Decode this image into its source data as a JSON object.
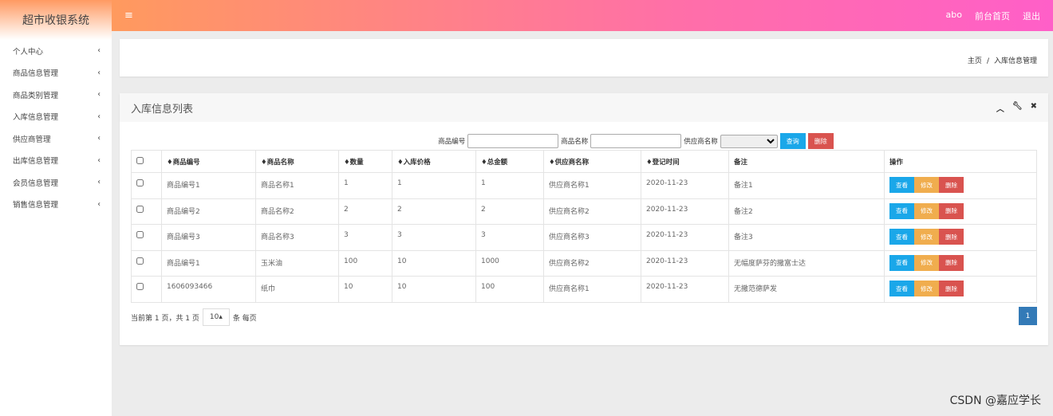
{
  "app_title": "超市收银系统",
  "sidebar": {
    "items": [
      "个人中心",
      "商品信息管理",
      "商品类别管理",
      "入库信息管理",
      "供应商管理",
      "出库信息管理",
      "会员信息管理",
      "销售信息管理"
    ]
  },
  "header": {
    "user": "abo",
    "home": "前台首页",
    "logout": "退出"
  },
  "breadcrumb": {
    "home": "主页",
    "sep": "/",
    "current": "入库信息管理"
  },
  "panel": {
    "title": "入库信息列表"
  },
  "search": {
    "code_label": "商品编号",
    "name_label": "商品名称",
    "supplier_label": "供应商名称",
    "query": "查询",
    "delete": "删除"
  },
  "table": {
    "headers": [
      "♦商品编号",
      "♦商品名称",
      "♦数量",
      "♦入库价格",
      "♦总金额",
      "♦供应商名称",
      "♦登记时间",
      "备注",
      "操作"
    ],
    "rows": [
      [
        "商品编号1",
        "商品名称1",
        "1",
        "1",
        "1",
        "供应商名称1",
        "2020-11-23",
        "备注1"
      ],
      [
        "商品编号2",
        "商品名称2",
        "2",
        "2",
        "2",
        "供应商名称2",
        "2020-11-23",
        "备注2"
      ],
      [
        "商品编号3",
        "商品名称3",
        "3",
        "3",
        "3",
        "供应商名称3",
        "2020-11-23",
        "备注3"
      ],
      [
        "商品编号1",
        "玉米油",
        "100",
        "10",
        "1000",
        "供应商名称2",
        "2020-11-23",
        "无幅度萨芬的撒富士达"
      ],
      [
        "1606093466",
        "纸巾",
        "10",
        "10",
        "100",
        "供应商名称1",
        "2020-11-23",
        "无撒范德萨发"
      ]
    ],
    "actions": {
      "view": "查看",
      "edit": "修改",
      "delete": "删除"
    }
  },
  "pager": {
    "info": "当前第 1 页，共 1 页",
    "size": "10▴",
    "per": "条 每页",
    "page": "1"
  },
  "watermark": "CSDN @嘉应学长"
}
